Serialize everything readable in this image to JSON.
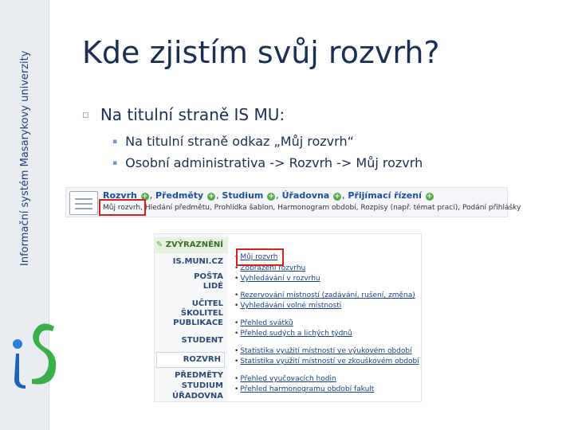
{
  "sidebar": {
    "vertical_text": "Informační systém Masarykovy univerzity",
    "logo": "iS"
  },
  "slide": {
    "title": "Kde zjistím svůj rozvrh?",
    "bullet_mark": "▫",
    "sub_mark": "▪",
    "bullet": "Na titulní straně IS MU:",
    "subbullets": [
      "Na titulní straně odkaz „Můj rozvrh“",
      "Osobní administrativa -> Rozvrh -> Můj rozvrh"
    ]
  },
  "screenshot_menubar": {
    "icon": "calendar-icon",
    "top_items": [
      "Rozvrh",
      "Předměty",
      "Studium",
      "Úřadovna",
      "Přijímací řízení"
    ],
    "sub_text": "Můj rozvrh, Hledání předmětu, Prohlídka šablon, Harmonogram období, Rozpisy (např. témat prací), Podání přihlášky",
    "plus_glyph": "+",
    "separator": ","
  },
  "screenshot_menu": {
    "highlight_label": "ZVÝRAZNĚNÍ",
    "left_items": [
      "IS.MUNI.CZ",
      "POŠTA",
      "LIDÉ",
      "UČITEL",
      "ŠKOLITEL",
      "PUBLIKACE",
      "STUDENT",
      "ROZVRH",
      "PŘEDMĚTY",
      "STUDIUM",
      "ÚŘADOVNA"
    ],
    "links": [
      "Můj rozvrh",
      "Zobrazení rozvrhu",
      "Vyhledávání v rozvrhu",
      "Rezervování místností (zadávání, rušení, změna)",
      "Vyhledávání volné místnosti",
      "Přehled svátků",
      "Přehled sudých a lichých týdnů",
      "Statistika využití místností ve výukovém období",
      "Statistika využití místností ve zkouškovém období",
      "Přehled vyučovacích hodin",
      "Přehled harmonogramu období fakult"
    ]
  },
  "colors": {
    "title": "#1b2e56",
    "link": "#1a3f8a",
    "highlight_box": "#d62020",
    "accent": "#6f9acb"
  }
}
